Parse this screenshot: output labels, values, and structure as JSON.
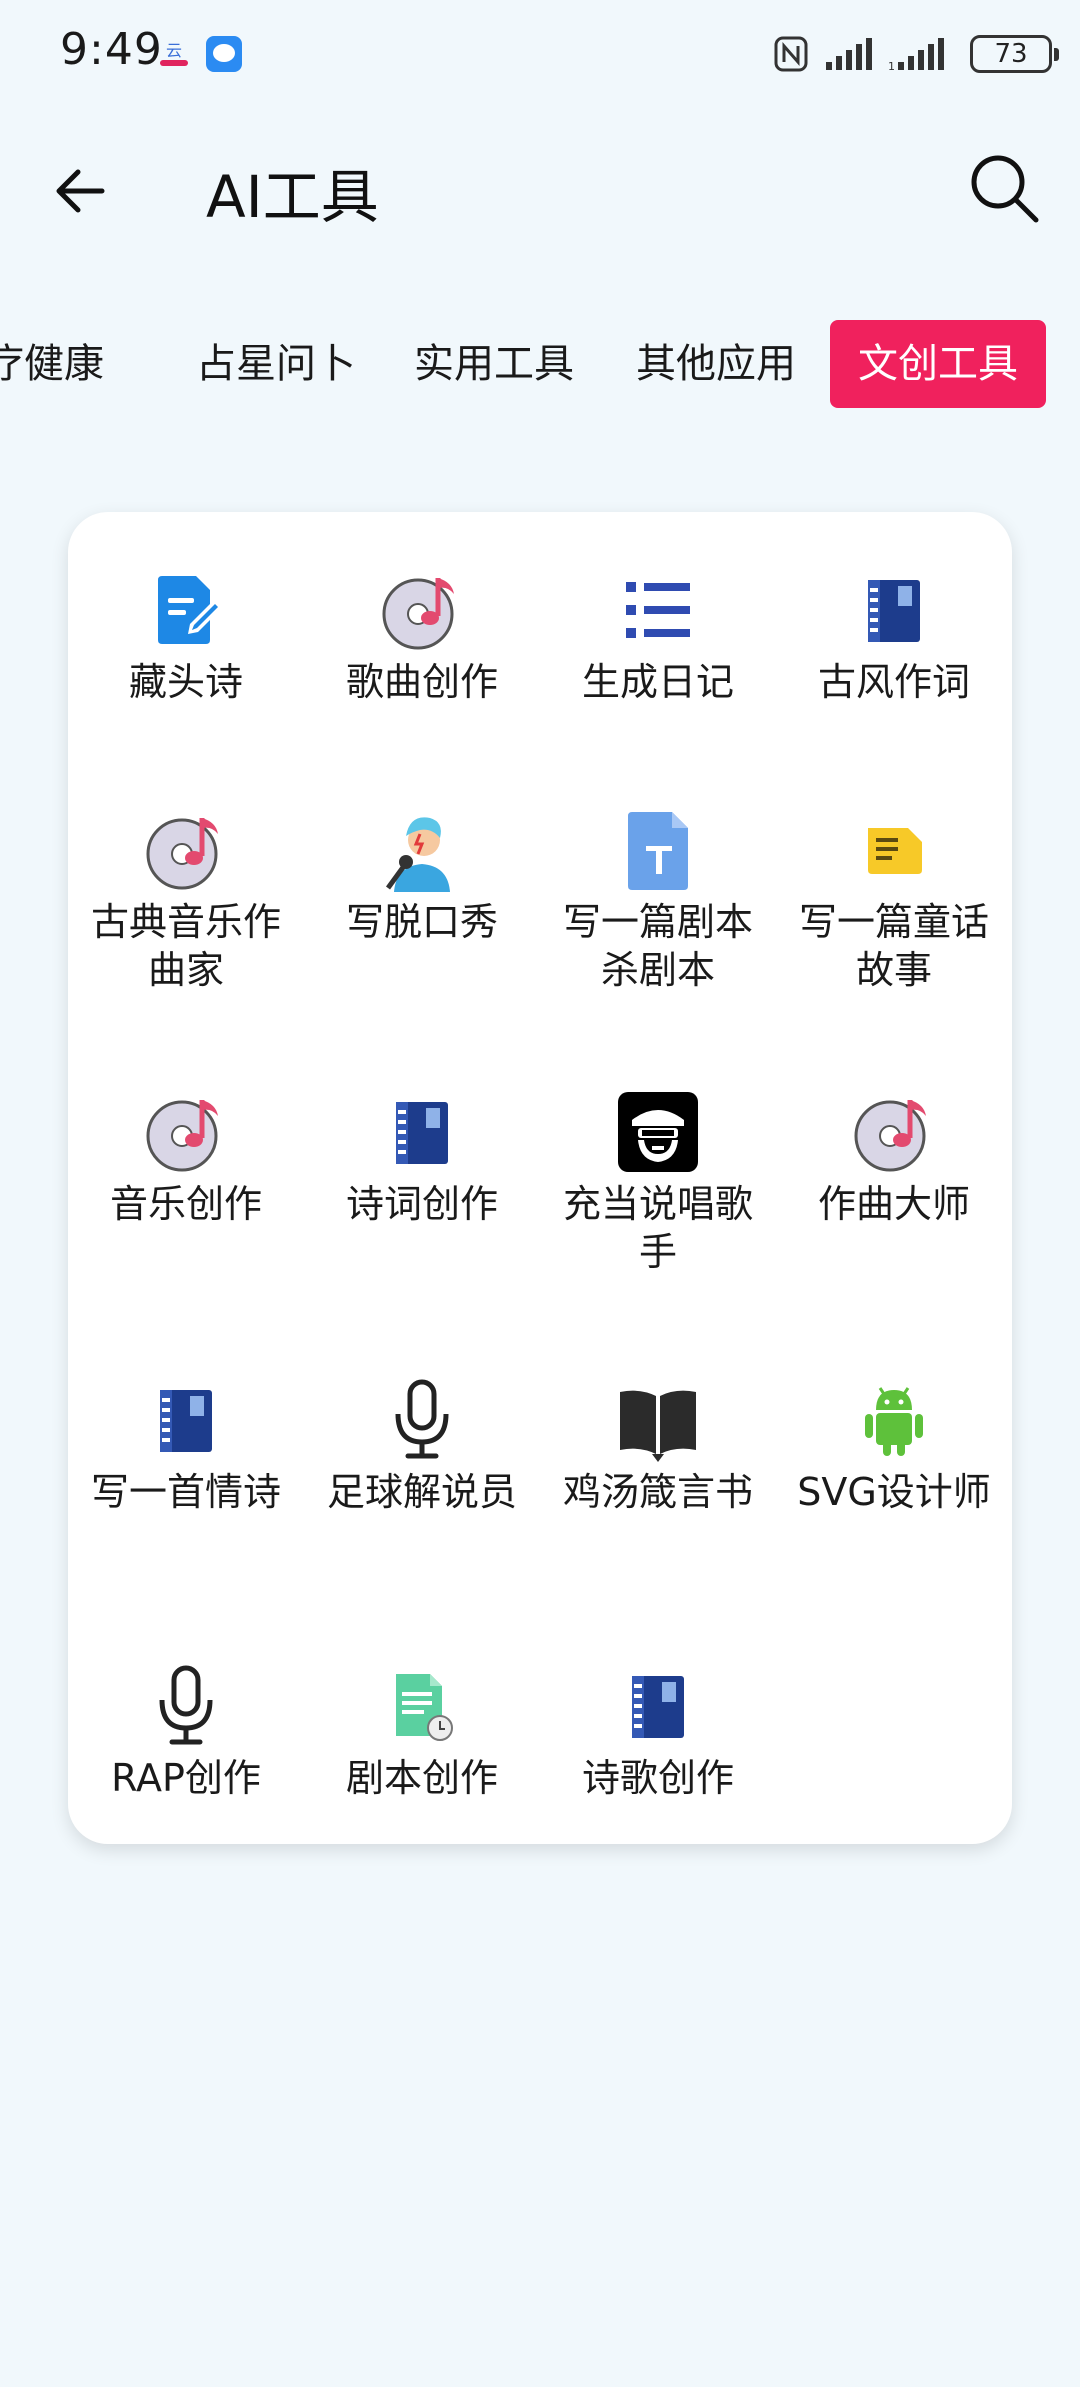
{
  "status_bar": {
    "time": "9:49",
    "battery": "73"
  },
  "header": {
    "title": "AI工具"
  },
  "tabs": [
    {
      "label": "健康",
      "prefix": "疗",
      "active": false
    },
    {
      "label": "占星问卜",
      "active": false
    },
    {
      "label": "实用工具",
      "active": false
    },
    {
      "label": "其他应用",
      "active": false
    },
    {
      "label": "文创工具",
      "active": true
    }
  ],
  "tools": [
    {
      "label": "藏头诗",
      "icon": "edit-document-icon"
    },
    {
      "label": "歌曲创作",
      "icon": "music-disc-icon"
    },
    {
      "label": "生成日记",
      "icon": "list-icon"
    },
    {
      "label": "古风作词",
      "icon": "notebook-icon"
    },
    {
      "label": "古典音乐作曲家",
      "icon": "music-disc-icon"
    },
    {
      "label": "写脱口秀",
      "icon": "singer-icon"
    },
    {
      "label": "写一篇剧本杀剧本",
      "icon": "text-document-icon"
    },
    {
      "label": "写一篇童话故事",
      "icon": "sticky-note-icon"
    },
    {
      "label": "音乐创作",
      "icon": "music-disc-icon"
    },
    {
      "label": "诗词创作",
      "icon": "notebook-icon"
    },
    {
      "label": "充当说唱歌手",
      "icon": "rapper-avatar-icon"
    },
    {
      "label": "作曲大师",
      "icon": "music-disc-icon"
    },
    {
      "label": "写一首情诗",
      "icon": "notebook-icon"
    },
    {
      "label": "足球解说员",
      "icon": "microphone-icon"
    },
    {
      "label": "鸡汤箴言书",
      "icon": "open-book-icon"
    },
    {
      "label": "SVG设计师",
      "icon": "android-icon"
    },
    {
      "label": "RAP创作",
      "icon": "microphone-icon"
    },
    {
      "label": "剧本创作",
      "icon": "script-document-icon"
    },
    {
      "label": "诗歌创作",
      "icon": "notebook-icon"
    }
  ],
  "colors": {
    "accent": "#f0215d",
    "background": "#f1f8fc",
    "card": "#ffffff"
  }
}
